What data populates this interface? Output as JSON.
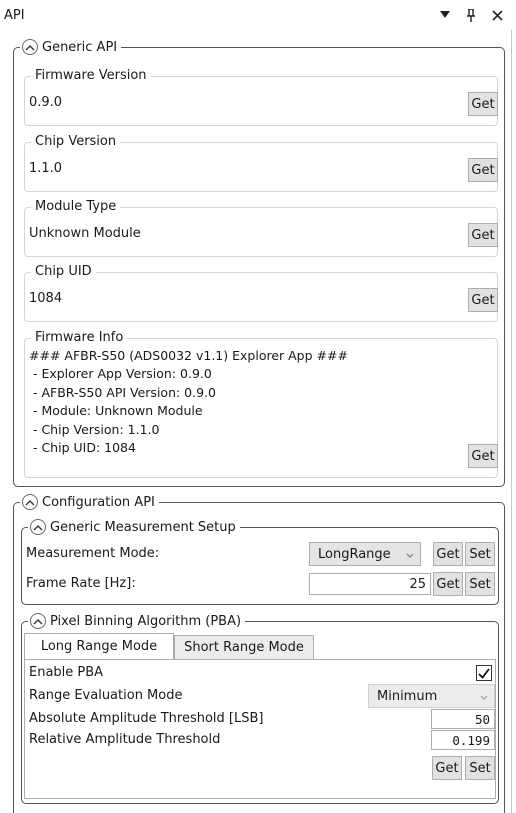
{
  "panel": {
    "title": "API"
  },
  "generic_api": {
    "title": "Generic API",
    "firmware_version": {
      "label": "Firmware Version",
      "value": "0.9.0",
      "button": "Get"
    },
    "chip_version": {
      "label": "Chip Version",
      "value": "1.1.0",
      "button": "Get"
    },
    "module_type": {
      "label": "Module Type",
      "value": "Unknown Module",
      "button": "Get"
    },
    "chip_uid": {
      "label": "Chip UID",
      "value": "1084",
      "button": "Get"
    },
    "firmware_info": {
      "label": "Firmware Info",
      "lines": [
        "### AFBR-S50 (ADS0032 v1.1) Explorer App ###",
        " - Explorer App Version: 0.9.0",
        " - AFBR-S50 API Version: 0.9.0",
        " - Module: Unknown Module",
        " - Chip Version: 1.1.0",
        " - Chip UID: 1084"
      ],
      "button": "Get"
    }
  },
  "configuration_api": {
    "title": "Configuration API",
    "measurement_setup": {
      "title": "Generic Measurement Setup",
      "measurement_mode": {
        "label": "Measurement Mode:",
        "value": "LongRange",
        "get": "Get",
        "set": "Set"
      },
      "frame_rate": {
        "label": "Frame Rate [Hz]:",
        "value": "25",
        "get": "Get",
        "set": "Set"
      }
    },
    "pba": {
      "title": "Pixel Binning Algorithm (PBA)",
      "tabs": [
        "Long Range Mode",
        "Short Range Mode"
      ],
      "enable_pba": {
        "label": "Enable PBA",
        "checked": true
      },
      "range_eval_mode": {
        "label": "Range Evaluation Mode",
        "value": "Minimum"
      },
      "abs_threshold": {
        "label": "Absolute Amplitude Threshold [LSB]",
        "value": "50"
      },
      "rel_threshold": {
        "label": "Relative Amplitude Threshold",
        "value": "0.199"
      },
      "get": "Get",
      "set": "Set"
    }
  }
}
